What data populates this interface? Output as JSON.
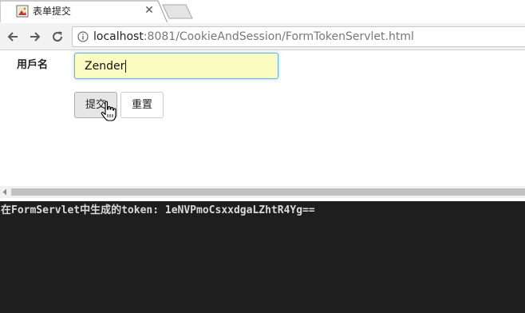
{
  "tab": {
    "title": "表单提交",
    "favicon": "picture-icon",
    "close_icon": "close-icon"
  },
  "toolbar": {
    "back_icon": "arrow-left-icon",
    "forward_icon": "arrow-right-icon",
    "reload_icon": "reload-icon",
    "info_icon": "info-icon",
    "url_host": "localhost",
    "url_rest": ":8081/CookieAndSession/FormTokenServlet.html"
  },
  "form": {
    "username_label": "用戶名",
    "username_value": "Zender",
    "submit_label": "提交",
    "reset_label": "重置"
  },
  "console": {
    "line": "在FormServlet中生成的token: 1eNVPmoCsxxdgaLZhtR4Yg=="
  },
  "colors": {
    "input_bg": "#fafcc2",
    "input_focus": "#66afe9",
    "console_bg": "#1e1e1e",
    "console_text": "#d9d9d9"
  }
}
